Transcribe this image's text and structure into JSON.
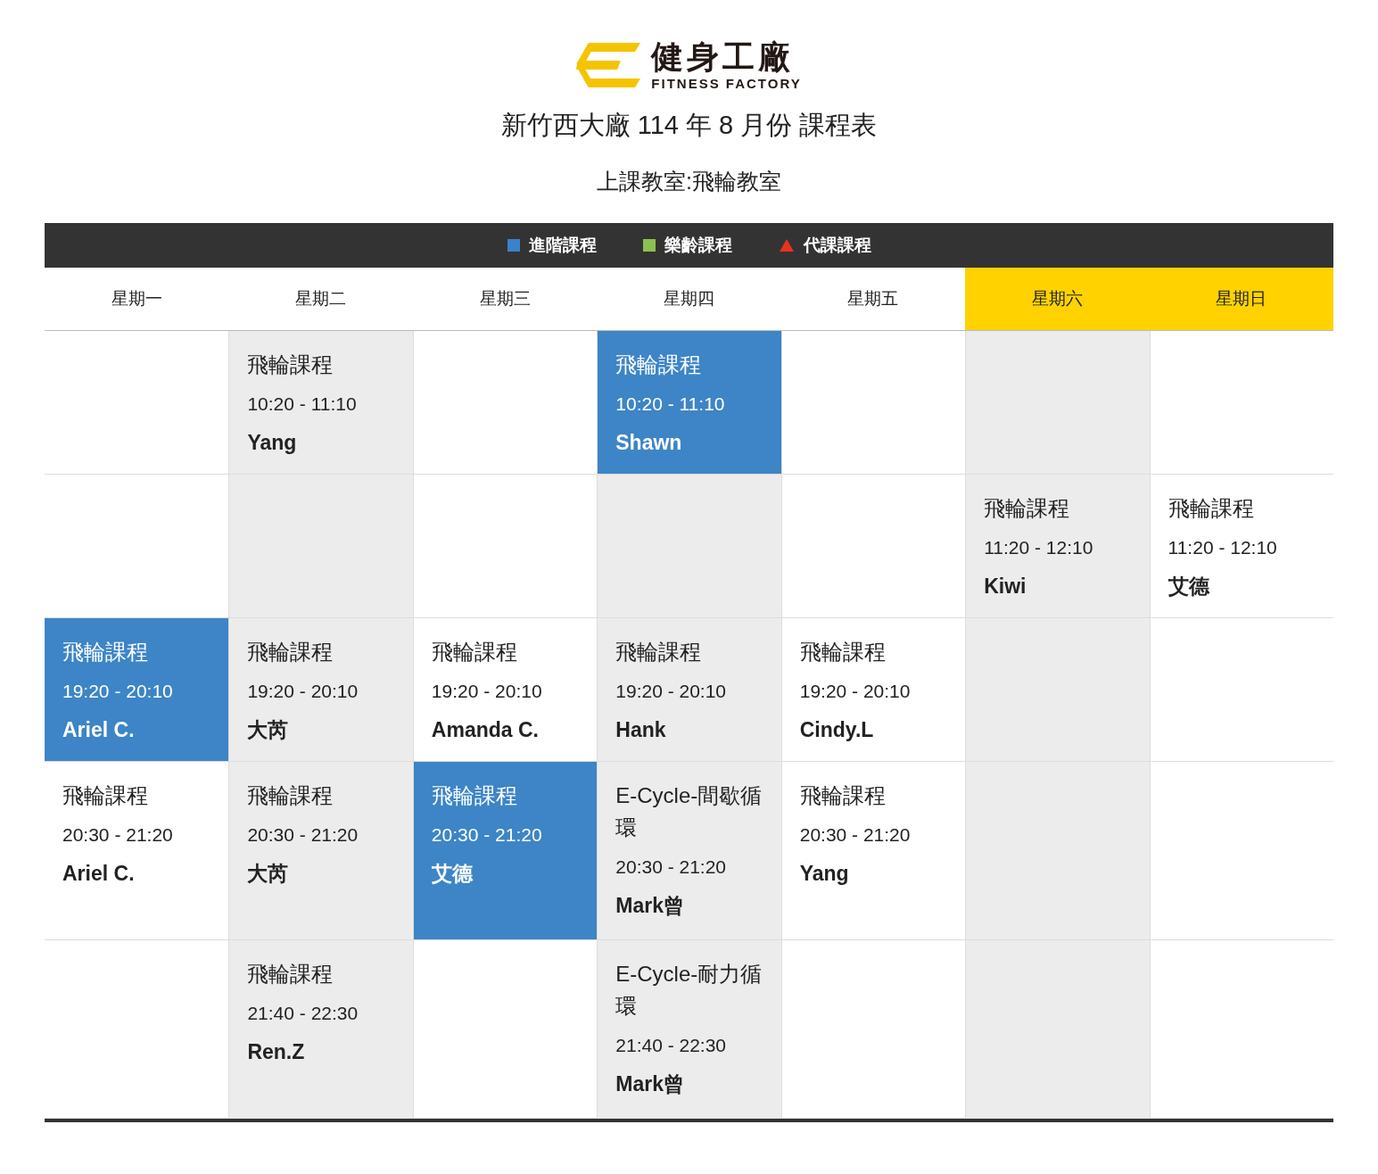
{
  "logo": {
    "name": "健身工廠",
    "subtitle": "FITNESS FACTORY"
  },
  "title": "新竹西大廠 114 年 8 月份 課程表",
  "room": "上課教室:飛輪教室",
  "legend": [
    {
      "kind": "square",
      "color": "#3b82c8",
      "label": "進階課程"
    },
    {
      "kind": "square",
      "color": "#8cc152",
      "label": "樂齡課程"
    },
    {
      "kind": "triangle",
      "color": "#e8321e",
      "label": "代課課程"
    }
  ],
  "days": [
    {
      "label": "星期一",
      "weekend": false
    },
    {
      "label": "星期二",
      "weekend": false
    },
    {
      "label": "星期三",
      "weekend": false
    },
    {
      "label": "星期四",
      "weekend": false
    },
    {
      "label": "星期五",
      "weekend": false
    },
    {
      "label": "星期六",
      "weekend": true
    },
    {
      "label": "星期日",
      "weekend": true
    }
  ],
  "rows": [
    {
      "cells": [
        {
          "kind": "empty"
        },
        {
          "kind": "class",
          "title": "飛輪課程",
          "time": "10:20 - 11:10",
          "coach": "Yang",
          "advanced": false
        },
        {
          "kind": "empty"
        },
        {
          "kind": "class",
          "title": "飛輪課程",
          "time": "10:20 - 11:10",
          "coach": "Shawn",
          "advanced": true
        },
        {
          "kind": "empty"
        },
        {
          "kind": "empty"
        },
        {
          "kind": "empty"
        }
      ]
    },
    {
      "cells": [
        {
          "kind": "empty"
        },
        {
          "kind": "empty"
        },
        {
          "kind": "empty"
        },
        {
          "kind": "empty"
        },
        {
          "kind": "empty"
        },
        {
          "kind": "class",
          "title": "飛輪課程",
          "time": "11:20 - 12:10",
          "coach": "Kiwi",
          "advanced": false
        },
        {
          "kind": "class",
          "title": "飛輪課程",
          "time": "11:20 - 12:10",
          "coach": "艾德",
          "advanced": false
        }
      ]
    },
    {
      "cells": [
        {
          "kind": "class",
          "title": "飛輪課程",
          "time": "19:20 - 20:10",
          "coach": "Ariel C.",
          "advanced": true
        },
        {
          "kind": "class",
          "title": "飛輪課程",
          "time": "19:20 - 20:10",
          "coach": "大芮",
          "advanced": false
        },
        {
          "kind": "class",
          "title": "飛輪課程",
          "time": "19:20 - 20:10",
          "coach": "Amanda C.",
          "advanced": false
        },
        {
          "kind": "class",
          "title": "飛輪課程",
          "time": "19:20 - 20:10",
          "coach": "Hank",
          "advanced": false
        },
        {
          "kind": "class",
          "title": "飛輪課程",
          "time": "19:20 - 20:10",
          "coach": "Cindy.L",
          "advanced": false
        },
        {
          "kind": "empty"
        },
        {
          "kind": "empty"
        }
      ]
    },
    {
      "cells": [
        {
          "kind": "class",
          "title": "飛輪課程",
          "time": "20:30 - 21:20",
          "coach": "Ariel C.",
          "advanced": false
        },
        {
          "kind": "class",
          "title": "飛輪課程",
          "time": "20:30 - 21:20",
          "coach": "大芮",
          "advanced": false
        },
        {
          "kind": "class",
          "title": "飛輪課程",
          "time": "20:30 - 21:20",
          "coach": "艾德",
          "advanced": true
        },
        {
          "kind": "class",
          "title": "E-Cycle-間歇循環",
          "time": "20:30 - 21:20",
          "coach": "Mark曾",
          "advanced": false
        },
        {
          "kind": "class",
          "title": "飛輪課程",
          "time": "20:30 - 21:20",
          "coach": "Yang",
          "advanced": false
        },
        {
          "kind": "empty"
        },
        {
          "kind": "empty"
        }
      ]
    },
    {
      "cells": [
        {
          "kind": "empty"
        },
        {
          "kind": "class",
          "title": "飛輪課程",
          "time": "21:40 - 22:30",
          "coach": "Ren.Z",
          "advanced": false
        },
        {
          "kind": "empty"
        },
        {
          "kind": "class",
          "title": "E-Cycle-耐力循環",
          "time": "21:40 - 22:30",
          "coach": "Mark曾",
          "advanced": false
        },
        {
          "kind": "empty"
        },
        {
          "kind": "empty"
        },
        {
          "kind": "empty"
        }
      ]
    }
  ]
}
